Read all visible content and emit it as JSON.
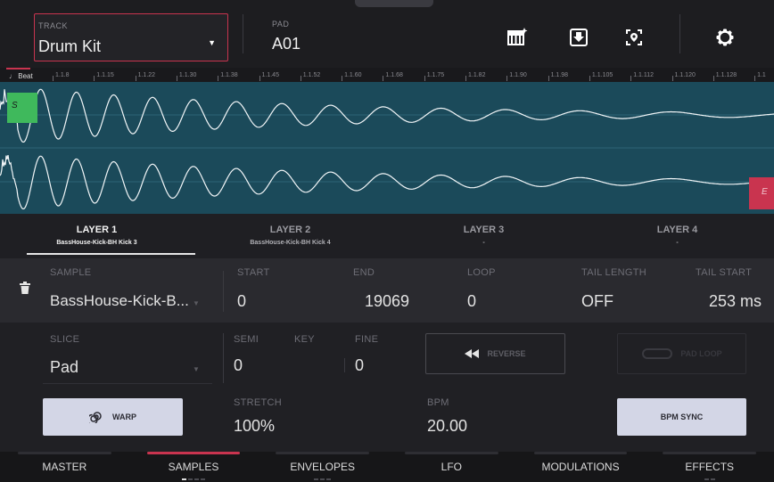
{
  "track": {
    "label": "TRACK",
    "value": "Drum Kit"
  },
  "pad": {
    "label": "PAD",
    "value": "A01"
  },
  "ruler": {
    "beat_label": "Beat",
    "ticks": [
      "1.1.8",
      "1.1.15",
      "1.1.22",
      "1.1.30",
      "1.1.38",
      "1.1.45",
      "1.1.52",
      "1.1.60",
      "1.1.68",
      "1.1.75",
      "1.1.82",
      "1.1.90",
      "1.1.98",
      "1.1.105",
      "1.1.112",
      "1.1.120",
      "1.1.128",
      "1.1"
    ]
  },
  "markers": {
    "start": "S",
    "end": "E"
  },
  "layers": [
    {
      "name": "LAYER 1",
      "sample": "BassHouse-Kick-BH Kick 3",
      "active": true
    },
    {
      "name": "LAYER 2",
      "sample": "BassHouse-Kick-BH Kick 4",
      "active": false
    },
    {
      "name": "LAYER 3",
      "sample": "-",
      "active": false
    },
    {
      "name": "LAYER 4",
      "sample": "-",
      "active": false
    }
  ],
  "row1": {
    "sample_label": "SAMPLE",
    "sample_value": "BassHouse-Kick-B...",
    "start_label": "START",
    "start_value": "0",
    "end_label": "END",
    "end_value": "19069",
    "loop_label": "LOOP",
    "loop_value": "0",
    "tail_length_label": "TAIL LENGTH",
    "tail_length_value": "OFF",
    "tail_start_label": "TAIL START",
    "tail_start_value": "253 ms"
  },
  "row2": {
    "slice_label": "SLICE",
    "slice_value": "Pad",
    "semi_label": "SEMI",
    "semi_value": "0",
    "key_label": "KEY",
    "fine_label": "FINE",
    "fine_value": "0",
    "reverse_label": "REVERSE",
    "padloop_label": "PAD LOOP",
    "warp_label": "WARP",
    "stretch_label": "STRETCH",
    "stretch_value": "100%",
    "bpm_label": "BPM",
    "bpm_value": "20.00",
    "bpmsync_label": "BPM SYNC"
  },
  "bottom_tabs": [
    {
      "label": "MASTER",
      "active": false,
      "dots": 0,
      "on": 0
    },
    {
      "label": "SAMPLES",
      "active": true,
      "dots": 4,
      "on": 1
    },
    {
      "label": "ENVELOPES",
      "active": false,
      "dots": 3,
      "on": 0
    },
    {
      "label": "LFO",
      "active": false,
      "dots": 0,
      "on": 0
    },
    {
      "label": "MODULATIONS",
      "active": false,
      "dots": 0,
      "on": 0
    },
    {
      "label": "EFFECTS",
      "active": false,
      "dots": 2,
      "on": 0
    }
  ],
  "colors": {
    "accent": "#c9344f",
    "waveform_bg": "#1b4a5a",
    "start_marker": "#3fb95c",
    "button_light": "#d3d6e6"
  },
  "icons": [
    "keyboard-sparkle-icon",
    "download-icon",
    "locate-icon",
    "gear-icon",
    "trash-icon",
    "rewind-icon",
    "loop-icon",
    "warp-spiral-icon"
  ]
}
